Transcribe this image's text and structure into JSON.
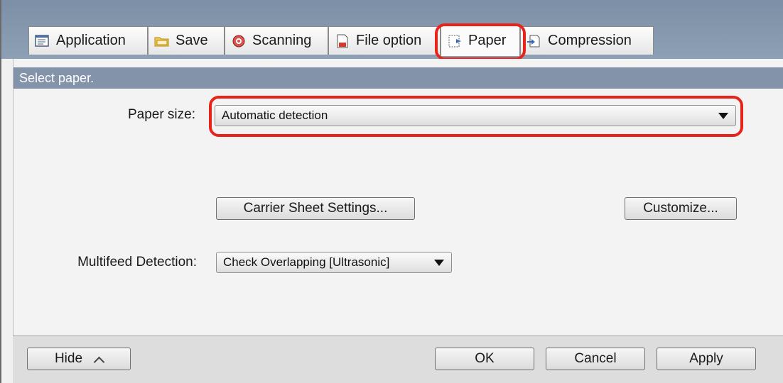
{
  "tabs": [
    {
      "label": "Application",
      "icon": "application-icon"
    },
    {
      "label": "Save",
      "icon": "folder-icon"
    },
    {
      "label": "Scanning",
      "icon": "scanning-icon"
    },
    {
      "label": "File option",
      "icon": "file-option-icon"
    },
    {
      "label": "Paper",
      "icon": "paper-icon",
      "active": true
    },
    {
      "label": "Compression",
      "icon": "compression-icon"
    }
  ],
  "section": {
    "title": "Select paper."
  },
  "paper_size": {
    "label": "Paper size:",
    "value": "Automatic detection"
  },
  "buttons": {
    "carrier": "Carrier Sheet Settings...",
    "customize": "Customize..."
  },
  "multifeed": {
    "label": "Multifeed Detection:",
    "value": "Check Overlapping [Ultrasonic]"
  },
  "footer": {
    "hide": "Hide",
    "ok": "OK",
    "cancel": "Cancel",
    "apply": "Apply"
  },
  "colors": {
    "highlight": "#e8231a",
    "section_bar": "#8393aa",
    "tab_strip": "#8193aa"
  }
}
